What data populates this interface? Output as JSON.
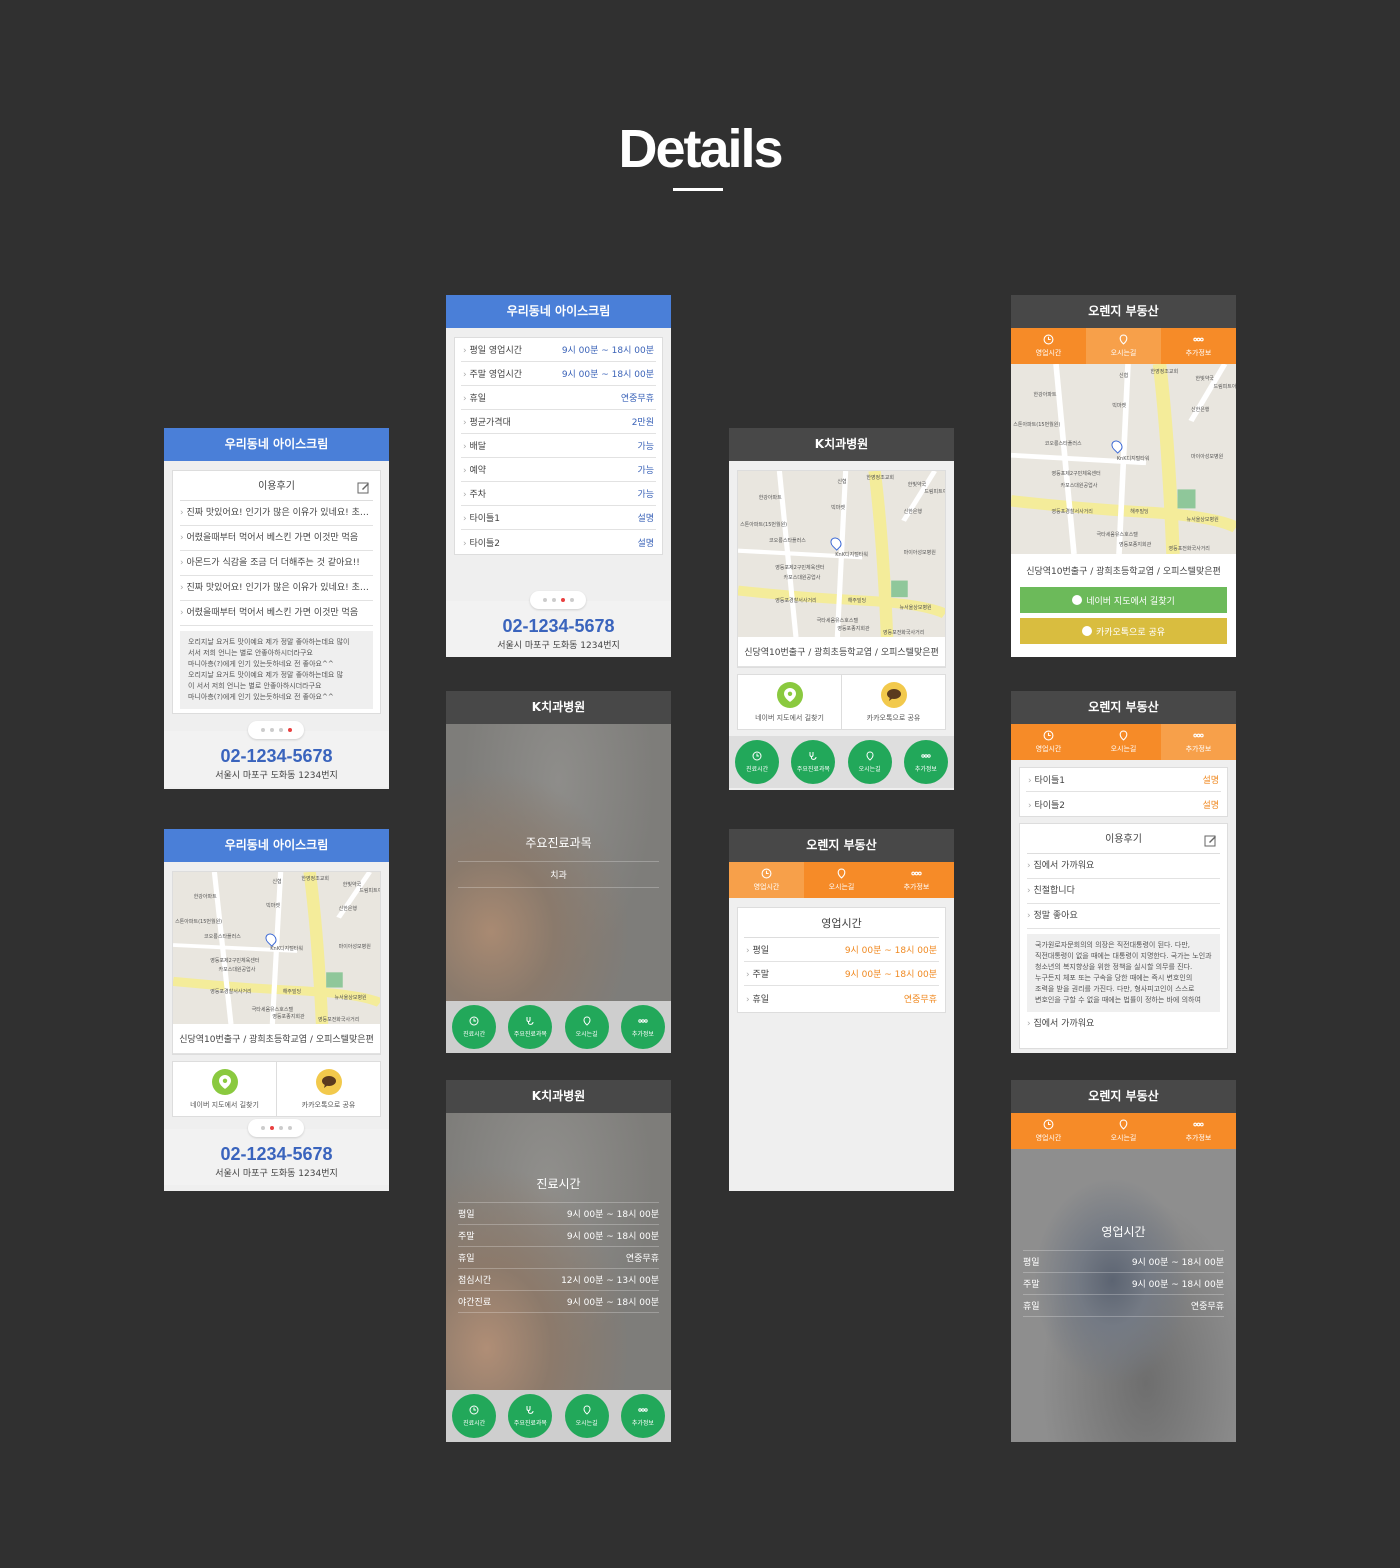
{
  "page": {
    "heading": "Details"
  },
  "common": {
    "phone": "02-1234-5678",
    "address": "서울시 마포구 도화동 1234번지",
    "map_address": "신당역10번출구 / 광희초등학교엽 / 오피스텔맞은편",
    "naver_map": "네이버 지도에서 길찾기",
    "kakao_share": "카카오톡으로 공유"
  },
  "map": {
    "labels": [
      "신협",
      "한영정조교회",
      "한빛약국",
      "한강아파트",
      "빅마켓",
      "신한은행",
      "드림피트아파트",
      "스톤아파트(15번월원)",
      "코오롱스타플러스",
      "영등포제2구민체육센터",
      "KnK디지털타워",
      "카포스대원공업사",
      "마이아성모병원",
      "영등포경찰서사거리",
      "해주빌딩",
      "뉴서울상모병원",
      "극타세움유스호스텔",
      "영등포종지회관",
      "영등포전화국사거리"
    ],
    "pin_letter": "D"
  },
  "ice": {
    "title": "우리동네 아이스크림",
    "review_title": "이용후기",
    "reviews": [
      "진짜 맛있어요! 인기가 많은 이유가 있네요! 초코...",
      "어렸을때부터 먹어서 베스킨 가면 이것만 먹음",
      "아몬드가 식감을 조금 더 더해주는 것 같아요!!",
      "진짜 맛있어요! 인기가 많은 이유가 있네요! 초코...",
      "어렸을때부터 먹어서 베스킨 가면 이것만 먹음"
    ],
    "review_body": [
      "오리지날 요거트 맛이예요 제가 정말 좋아하는데요 많이",
      "서서 저희 언니는 별로 안좋아하시더라구요",
      "마니아층(?)에게 인기 있는듯하네요 전 좋아요^^",
      "오리지날 요거트 맛이예요 제가 정말 좋아하는데요 많",
      "이 서서 저희 언니는 별로 안좋아하시더라구요",
      "마니아층(?)에게 인기 있는듯하네요 전 좋아요^^"
    ],
    "info": [
      {
        "k": "평일 영업시간",
        "v": "9시 00분 ~ 18시 00분"
      },
      {
        "k": "주말 영업시간",
        "v": "9시 00분 ~ 18시 00분"
      },
      {
        "k": "휴일",
        "v": "연중무휴"
      },
      {
        "k": "평균가격대",
        "v": "2만원"
      },
      {
        "k": "배달",
        "v": "가능"
      },
      {
        "k": "예약",
        "v": "가능"
      },
      {
        "k": "주차",
        "v": "가능"
      },
      {
        "k": "타이틀1",
        "v": "설명"
      },
      {
        "k": "타이틀2",
        "v": "설명"
      }
    ]
  },
  "dental": {
    "title": "K치과병원",
    "buttons": [
      "진료시간",
      "주요진료과목",
      "오시는길",
      "추가정보"
    ],
    "subject_title": "주요진료과목",
    "subject_value": "치과",
    "hours_title": "진료시간",
    "hours": [
      {
        "k": "평일",
        "v": "9시 00분 ~ 18시 00분"
      },
      {
        "k": "주말",
        "v": "9시 00분 ~ 18시 00분"
      },
      {
        "k": "휴일",
        "v": "연중무휴"
      },
      {
        "k": "점심시간",
        "v": "12시 00분 ~ 13시 00분"
      },
      {
        "k": "야간진료",
        "v": "9시 00분 ~ 18시 00분"
      }
    ]
  },
  "realty": {
    "title": "오렌지 부동산",
    "tabs": [
      "영업시간",
      "오시는길",
      "추가정보"
    ],
    "hours_title": "영업시간",
    "hours": [
      {
        "k": "평일",
        "v": "9시 00분 ~ 18시 00분"
      },
      {
        "k": "주말",
        "v": "9시 00분 ~ 18시 00분"
      },
      {
        "k": "휴일",
        "v": "연중무휴"
      }
    ],
    "info": [
      {
        "k": "타이틀1",
        "v": "설명"
      },
      {
        "k": "타이틀2",
        "v": "설명"
      }
    ],
    "review_title": "이용후기",
    "reviews": [
      "집에서 가까워요",
      "친절합니다",
      "정말 좋아요"
    ],
    "review_body": [
      "국가원로자문회의의 의장은 직전대통령이 된다. 다만,",
      "직전대통령이 없을 때에는 대통령이 지명한다. 국가는 노인과",
      "청소년의 복지향상을 위한 정책을 실시할 의무를 진다.",
      "누구든지 체포 또는 구속을 당한 때에는 즉시 변호인의",
      "조력을 받을 권리를 가진다. 다만, 형사피고인이 스스로",
      "변호인을 구할 수 없을 때에는 법률이 정하는 바에 의하여"
    ],
    "last_review": "집에서 가까워요",
    "naver_btn": "네이버 지도에서 길찾기",
    "kakao_btn": "카카오톡으로 공유"
  },
  "colors": {
    "blue": "#4a7fd8",
    "orange": "#f68b28",
    "green": "#22a85a",
    "naver": "#6cba5a",
    "kakao": "#d9bd3f"
  }
}
